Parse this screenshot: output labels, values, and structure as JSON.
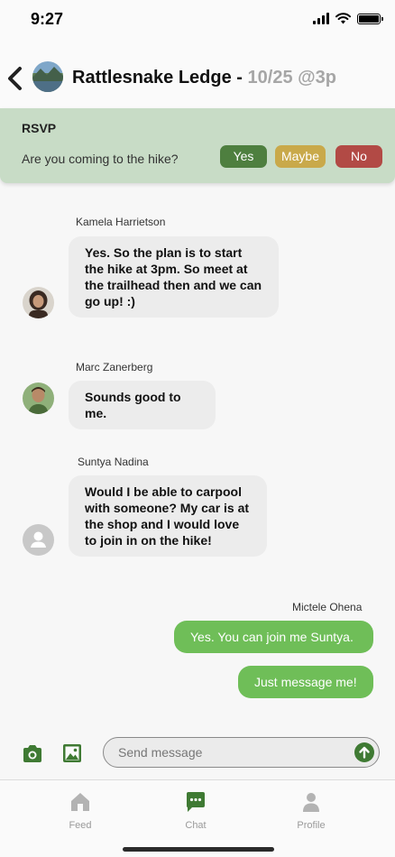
{
  "status_bar": {
    "time": "9:27"
  },
  "header": {
    "title": "Rattlesnake Ledge - ",
    "subtitle": "10/25 @3p"
  },
  "rsvp": {
    "label": "RSVP",
    "question": "Are you coming to the hike?",
    "yes": "Yes",
    "maybe": "Maybe",
    "no": "No"
  },
  "messages": [
    {
      "sender": "Kamela Harrietson",
      "text": "Yes. So the plan is to start the hike at 3pm. So meet at the trailhead then and we can go up! :)"
    },
    {
      "sender": "Marc Zanerberg",
      "text": "Sounds good to me."
    },
    {
      "sender": "Suntya Nadina",
      "text": "Would I be able to carpool with someone? My car is at the shop and I would love to join in on the hike!"
    },
    {
      "sender": "Mictele Ohena",
      "text": "Yes. You can join me Suntya."
    },
    {
      "text": "Just message me!"
    }
  ],
  "composer": {
    "placeholder": "Send message"
  },
  "tabs": [
    {
      "label": "Feed",
      "icon": "home-icon"
    },
    {
      "label": "Chat",
      "icon": "chat-icon"
    },
    {
      "label": "Profile",
      "icon": "person-icon"
    }
  ],
  "colors": {
    "accent_green": "#3f7a33",
    "rsvp_bg": "#c8dcc6",
    "yes": "#4e7f3f",
    "maybe": "#c9a94a",
    "no": "#b24a45",
    "my_bubble": "#6fbe58"
  }
}
